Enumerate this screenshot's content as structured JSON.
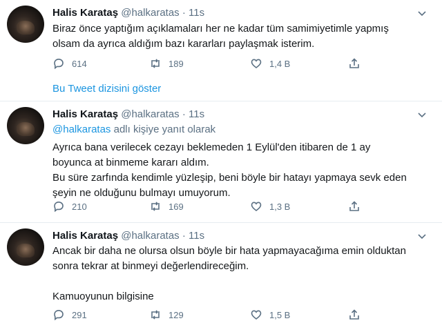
{
  "tweets": [
    {
      "name": "Halis Karataş",
      "handle": "@halkaratas",
      "time": "· 11s",
      "reply_prefix": "",
      "reply_suffix": "",
      "lines": [
        "Biraz önce yaptığım açıklamaları her ne kadar  tüm samimiyetimle yapmış",
        "olsam da ayrıca aldığım bazı kararları paylaşmak isterim."
      ],
      "replies": "614",
      "retweets": "189",
      "likes": "1,4 B"
    },
    {
      "name": "Halis Karataş",
      "handle": "@halkaratas",
      "time": "· 11s",
      "reply_prefix": "@halkaratas",
      "reply_suffix": " adlı kişiye yanıt olarak",
      "lines": [
        "Ayrıca bana verilecek cezayı beklemeden 1 Eylül'den itibaren de 1 ay",
        "boyunca at binmeme kararı aldım.",
        "Bu süre zarfında kendimle yüzleşip, beni böyle bir hatayı yapmaya sevk eden",
        "şeyin ne olduğunu bulmayı umuyorum."
      ],
      "replies": "210",
      "retweets": "169",
      "likes": "1,3 B"
    },
    {
      "name": "Halis Karataş",
      "handle": "@halkaratas",
      "time": "· 11s",
      "reply_prefix": "",
      "reply_suffix": "",
      "lines": [
        "Ancak bir daha ne olursa olsun böyle bir hata yapmayacağıma emin olduktan",
        "sonra tekrar at binmeyi değerlendireceğim.",
        "",
        "Kamuoyunun bilgisine"
      ],
      "replies": "291",
      "retweets": "129",
      "likes": "1,5 B"
    }
  ],
  "thread_link": "Bu Tweet dizisini göster",
  "icons": {
    "reply": "reply-icon",
    "retweet": "retweet-icon",
    "like": "like-icon",
    "share": "share-icon",
    "more": "chevron-down-icon"
  },
  "colors": {
    "link": "#1b95e0",
    "secondary": "#5b7083",
    "divider": "#e6ecf0"
  }
}
